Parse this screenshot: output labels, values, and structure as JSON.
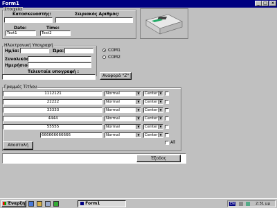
{
  "window": {
    "title": "Form1",
    "min": "_",
    "max": "□",
    "close": "×"
  },
  "stoixeia": {
    "group_label": "Στοιχεία",
    "manufacturer_label": "Κατασκευαστής:",
    "serial_label": "Σειριακός Αριθμός:",
    "manufacturer_value": "",
    "serial_value": "",
    "date_label": "Date:",
    "time_label": "Time:",
    "date_value": "Text1",
    "time_value": "Text2"
  },
  "signature": {
    "group_label": "Ηλεκτρονική Υπογραφή",
    "date_label": "Ημ/ία:",
    "time_label": "Ώρα:",
    "total_label": "Συνολικός:",
    "daily_label": "Ημερήσιος:",
    "last_label": "Τελευταία υπογραφή :",
    "date_value": "",
    "time_value": "",
    "total_value": "",
    "daily_value": "",
    "last_value": ""
  },
  "ports": {
    "com1": "COM1",
    "com2": "COM2",
    "selected": "COM1"
  },
  "report_button": "Αναφορά \"Z\"",
  "lines": {
    "group_label": "Γραμμές Τίτλου",
    "rows": [
      {
        "text": "1112121",
        "style": "Normal",
        "align": "Center"
      },
      {
        "text": "22222",
        "style": "Normal",
        "align": "Center"
      },
      {
        "text": "33333",
        "style": "Normal",
        "align": "Center"
      },
      {
        "text": "4444",
        "style": "Normal",
        "align": "Center"
      },
      {
        "text": "55555",
        "style": "Normal",
        "align": "Center"
      },
      {
        "text": "666666666666",
        "style": "Normal",
        "align": "Center"
      }
    ],
    "all_label": "All",
    "send_button": "Αποστολή"
  },
  "exit_button": "Έξοδος",
  "taskbar": {
    "start": "Έναρξη",
    "task": "Form1",
    "lang": "EN",
    "clock": "2:31 μμ"
  }
}
